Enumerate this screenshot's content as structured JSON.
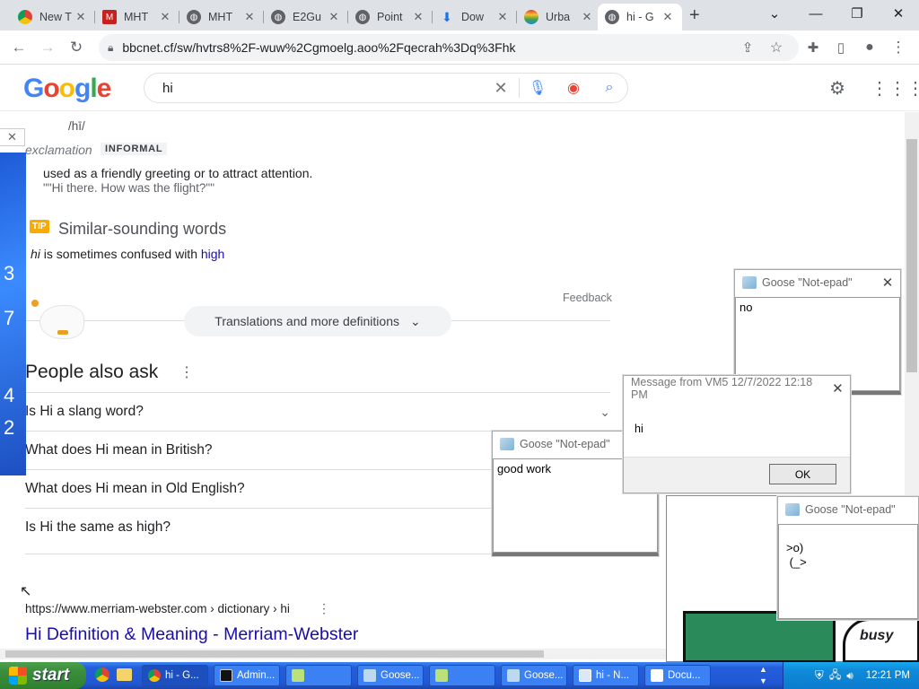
{
  "browser": {
    "tabs": [
      {
        "label": "New T",
        "icon": "chrome-icon"
      },
      {
        "label": "MHT",
        "icon": "gmail-icon"
      },
      {
        "label": "MHT",
        "icon": "globe-icon"
      },
      {
        "label": "E2Gu",
        "icon": "globe-icon"
      },
      {
        "label": "Point",
        "icon": "globe-icon"
      },
      {
        "label": "Dow",
        "icon": "download-icon"
      },
      {
        "label": "Urba",
        "icon": "rainbow-icon"
      },
      {
        "label": "hi - G",
        "icon": "globe-icon"
      }
    ],
    "new_tab": "+",
    "url": "bbcnet.cf/sw/hvtrs8%2F-wuw%2Cgmoelg.aoo%2Fqecrah%3Dq%3Fhk"
  },
  "google": {
    "logo": [
      "G",
      "o",
      "o",
      "g",
      "l",
      "e"
    ],
    "logo_colors": [
      "#4285f4",
      "#ea4335",
      "#fbbc05",
      "#4285f4",
      "#34a853",
      "#ea4335"
    ],
    "query": "hi"
  },
  "definition": {
    "pronunciation": "/hī/",
    "part_of_speech": "exclamation",
    "register": "INFORMAL",
    "meaning": "used as a friendly greeting or to attract attention.",
    "example": "\"\"Hi there. How was the flight?\"\"",
    "tip_badge": "TIP",
    "similar_heading": "Similar-sounding words",
    "similar_word": "hi",
    "similar_text": " is sometimes confused with ",
    "similar_link": "high",
    "feedback": "Feedback",
    "more_button": "Translations and more definitions"
  },
  "paa": {
    "heading": "People also ask",
    "questions": [
      "Is Hi a slang word?",
      "What does Hi mean in British?",
      "What does Hi mean in Old English?",
      "Is Hi the same as high?"
    ]
  },
  "result": {
    "breadcrumb": "https://www.merriam-webster.com › dictionary › hi",
    "title": "Hi Definition & Meaning - Merriam-Webster"
  },
  "sidestrip_digits": [
    "3",
    "7",
    "4",
    "2"
  ],
  "popups": {
    "note1": {
      "title": "Goose \"Not-epad\"",
      "text": "no"
    },
    "note2": {
      "title": "Goose \"Not-epad\"",
      "text": "good work"
    },
    "note3": {
      "title": "Goose \"Not-epad\"",
      "text": ">o)\n (_>"
    },
    "message": {
      "title": "Message from VM5 12/7/2022 12:18 PM",
      "text": "hi",
      "ok": "OK"
    },
    "busy_text": "busy"
  },
  "taskbar": {
    "start": "start",
    "tasks": [
      {
        "label": "hi - G...",
        "active": true
      },
      {
        "label": "Admin..."
      },
      {
        "label": ""
      },
      {
        "label": "Goose..."
      },
      {
        "label": ""
      },
      {
        "label": "Goose..."
      },
      {
        "label": "hi - N..."
      },
      {
        "label": "Docu..."
      }
    ],
    "clock": "12:21 PM"
  }
}
